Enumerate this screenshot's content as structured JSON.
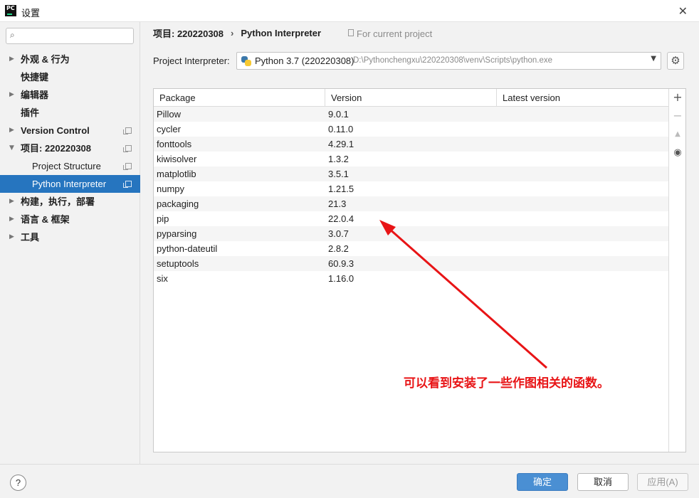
{
  "window": {
    "title": "设置",
    "app_icon_text": "PC"
  },
  "search": {
    "placeholder": "",
    "value": ""
  },
  "sidebar": {
    "items": [
      {
        "label": "外观 & 行为",
        "expandable": true
      },
      {
        "label": "快捷键",
        "expandable": false
      },
      {
        "label": "编辑器",
        "expandable": true
      },
      {
        "label": "插件",
        "expandable": false
      },
      {
        "label": "Version Control",
        "expandable": true
      },
      {
        "label": "项目: 220220308",
        "expandable": true,
        "expanded": true
      },
      {
        "label": "Project Structure",
        "child": true
      },
      {
        "label": "Python Interpreter",
        "child": true,
        "selected": true
      },
      {
        "label": "构建，执行，部署",
        "expandable": true
      },
      {
        "label": "语言 & 框架",
        "expandable": true
      },
      {
        "label": "工具",
        "expandable": true
      }
    ]
  },
  "breadcrumb": {
    "project": "项目: 220220308",
    "page": "Python Interpreter",
    "note": "For current project"
  },
  "interpreter": {
    "label": "Project Interpreter:",
    "name": "Python 3.7 (220220308)",
    "path": "D:\\Pythonchengxu\\220220308\\venv\\Scripts\\python.exe"
  },
  "table": {
    "headers": [
      "Package",
      "Version",
      "Latest version"
    ],
    "rows": [
      [
        "Pillow",
        "9.0.1",
        ""
      ],
      [
        "cycler",
        "0.11.0",
        ""
      ],
      [
        "fonttools",
        "4.29.1",
        ""
      ],
      [
        "kiwisolver",
        "1.3.2",
        ""
      ],
      [
        "matplotlib",
        "3.5.1",
        ""
      ],
      [
        "numpy",
        "1.21.5",
        ""
      ],
      [
        "packaging",
        "21.3",
        ""
      ],
      [
        "pip",
        "22.0.4",
        ""
      ],
      [
        "pyparsing",
        "3.0.7",
        ""
      ],
      [
        "python-dateutil",
        "2.8.2",
        ""
      ],
      [
        "setuptools",
        "60.9.3",
        ""
      ],
      [
        "six",
        "1.16.0",
        ""
      ]
    ]
  },
  "tools": {
    "add": "+",
    "remove": "−",
    "upgrade": "▲",
    "show": "👁"
  },
  "annotation": {
    "text": "可以看到安装了一些作图相关的函数。",
    "color": "#e81416"
  },
  "footer": {
    "help": "?",
    "ok": "确定",
    "cancel": "取消",
    "apply": "应用(A)"
  },
  "colors": {
    "selection": "#2675bf",
    "ok_button": "#4a8fd3"
  }
}
